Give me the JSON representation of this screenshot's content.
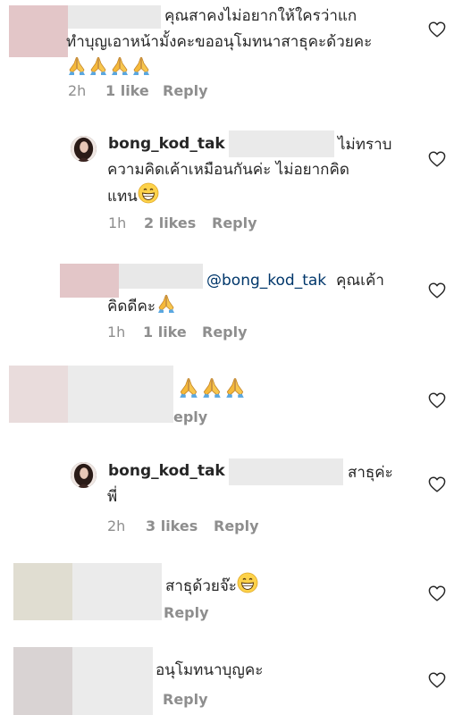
{
  "comments": [
    {
      "text_lines": [
        "คุณสาคงไม่อยากให้ใครว่าแก",
        "ทำบุญเอาหน้ามั้งคะขออนุโมทนาสาธุคะด้วยคะ"
      ],
      "emoji": [
        "folded-hands",
        "folded-hands",
        "folded-hands",
        "folded-hands"
      ],
      "time": "2h",
      "likes": "1 like",
      "reply": "Reply"
    },
    {
      "username": "bong_kod_tak",
      "text_lines": [
        "ไม่ทราบ",
        "ความคิดเค้าเหมือนกันค่ะ ไม่อยากคิด",
        "แทน"
      ],
      "emoji": [
        "grinning-face"
      ],
      "time": "1h",
      "likes": "2 likes",
      "reply": "Reply"
    },
    {
      "mention": "@bong_kod_tak",
      "text_lines": [
        "คุณเค้า",
        "คิดดีคะ"
      ],
      "emoji": [
        "folded-hands"
      ],
      "time": "1h",
      "likes": "1 like",
      "reply": "Reply"
    },
    {
      "emoji": [
        "folded-hands",
        "folded-hands",
        "folded-hands"
      ],
      "reply": "eply"
    },
    {
      "username": "bong_kod_tak",
      "text_lines": [
        "สาธุค่ะ",
        "พี่"
      ],
      "time": "2h",
      "likes": "3 likes",
      "reply": "Reply"
    },
    {
      "text_lines": [
        "สาธุด้วยจ๊ะ"
      ],
      "emoji": [
        "grinning-face"
      ],
      "reply": "Reply"
    },
    {
      "text_lines": [
        "อนุโมทนาบุญคะ"
      ],
      "reply": "Reply"
    }
  ],
  "icons": {
    "like": "heart-outline-icon",
    "avatar": "profile-photo"
  },
  "colors": {
    "text": "#262626",
    "meta": "#8e8e8e",
    "mention": "#00376b",
    "blur": "#eaeaea"
  }
}
